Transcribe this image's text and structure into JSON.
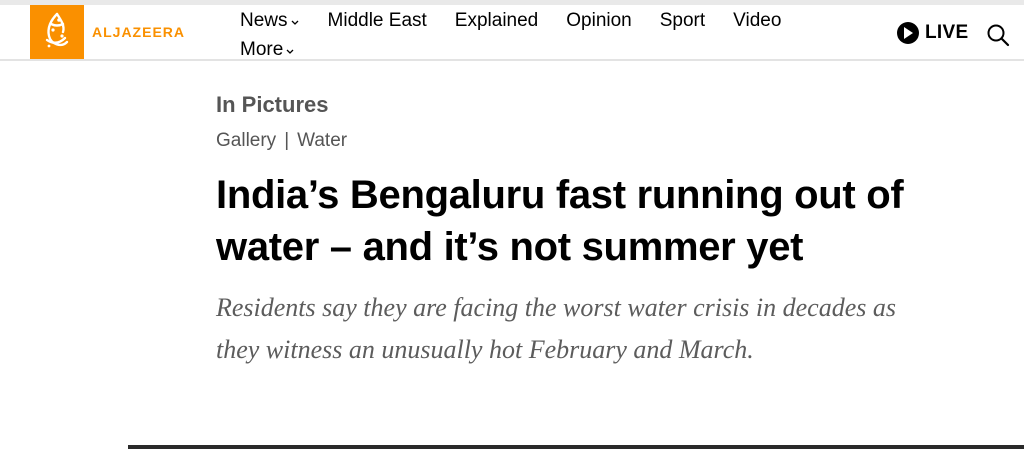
{
  "brand": {
    "logo_text": "ALJAZEERA",
    "accent_color": "#fa9000",
    "logo_icon": "aljazeera-calligraphy-icon"
  },
  "nav": {
    "items": [
      {
        "label": "News",
        "has_dropdown": true
      },
      {
        "label": "Middle East",
        "has_dropdown": false
      },
      {
        "label": "Explained",
        "has_dropdown": false
      },
      {
        "label": "Opinion",
        "has_dropdown": false
      },
      {
        "label": "Sport",
        "has_dropdown": false
      },
      {
        "label": "Video",
        "has_dropdown": false
      },
      {
        "label": "More",
        "has_dropdown": true
      }
    ],
    "live_label": "LIVE",
    "live_icon": "play-icon",
    "search_icon": "search-icon"
  },
  "article": {
    "section": "In Pictures",
    "breadcrumbs": [
      "Gallery",
      "Water"
    ],
    "breadcrumb_separator": "|",
    "headline": "India’s Bengaluru fast running out of water – and it’s not summer yet",
    "subheadline": "Residents say they are facing the worst water crisis in decades as they witness an unusually hot February and March."
  }
}
